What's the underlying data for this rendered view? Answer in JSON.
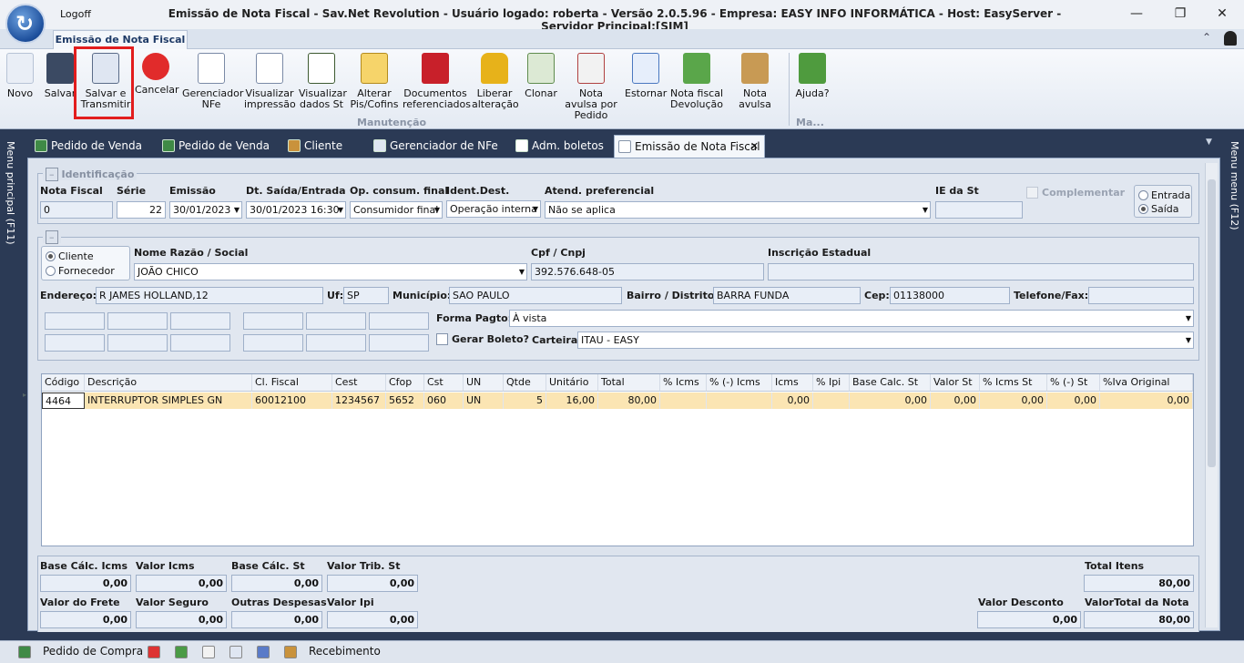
{
  "window": {
    "menu_logoff": "Logoff",
    "title": "Emissão de Nota Fiscal - Sav.Net Revolution - Usuário logado: roberta - Versão 2.0.5.96 - Empresa: EASY INFO INFORMÁTICA - Host: EasyServer - Servidor Principal:[SIM]",
    "minimize_glyph": "—",
    "maximize_glyph": "❐",
    "close_glyph": "✕"
  },
  "ribbon": {
    "tab": "Emissão de Nota Fiscal",
    "collapse_glyph": "⌃",
    "buttons": [
      {
        "label": "Novo",
        "icon": "new-document-icon"
      },
      {
        "label": "Salvar",
        "icon": "floppy-disk-icon"
      },
      {
        "label": "Salvar e Transmitir",
        "icon": "save-transmit-icon"
      },
      {
        "label": "Cancelar",
        "icon": "cancel-red-x-icon"
      },
      {
        "label": "Gerenciador NFe",
        "icon": "nfe-document-icon"
      },
      {
        "label": "Visualizar impressão",
        "icon": "print-preview-icon"
      },
      {
        "label": "Visualizar dados St",
        "icon": "calculator-st-icon"
      },
      {
        "label": "Alterar Pis/Cofins",
        "icon": "edit-pencil-icon"
      },
      {
        "label": "Documentos referenciados",
        "icon": "documents-arrow-icon"
      },
      {
        "label": "Liberar alteração",
        "icon": "padlock-icon"
      },
      {
        "label": "Clonar",
        "icon": "clone-icon"
      },
      {
        "label": "Nota avulsa por Pedido",
        "icon": "invoice-dollar-icon"
      },
      {
        "label": "Estornar",
        "icon": "reverse-icon"
      },
      {
        "label": "Nota fiscal Devolução",
        "icon": "return-invoice-icon"
      },
      {
        "label": "Nota avulsa",
        "icon": "clipboard-icon"
      },
      {
        "label": "Ajuda?",
        "icon": "help-book-icon"
      }
    ],
    "group_manutencao": "Manutenção",
    "group_ma": "Ma..."
  },
  "side": {
    "left": "Menu principal (F11)",
    "right": "Menu menu (F12)"
  },
  "doc_tabs": [
    {
      "label": "Pedido de Venda"
    },
    {
      "label": "Pedido de Venda"
    },
    {
      "label": "Cliente"
    },
    {
      "label": "Gerenciador de NFe"
    },
    {
      "label": "Adm. boletos"
    },
    {
      "label": "Emissão de Nota Fiscal",
      "close": "✕"
    }
  ],
  "identificacao": {
    "section": "Identificação",
    "nota_fiscal_label": "Nota Fiscal",
    "nota_fiscal": "0",
    "serie_label": "Série",
    "serie": "22",
    "emissao_label": "Emissão",
    "emissao": "30/01/2023",
    "dt_saida_label": "Dt. Saída/Entrada",
    "dt_saida": "30/01/2023 16:30",
    "op_consum_label": "Op. consum. final",
    "op_consum": "Consumidor final",
    "ident_dest_label": "Ident.Dest.",
    "ident_dest": "Operação interna",
    "atend_label": "Atend. preferencial",
    "atend": "Não se aplica",
    "ie_st_label": "IE da St",
    "ie_st": "",
    "complementar": "Complementar",
    "entrada": "Entrada",
    "saida": "Saída"
  },
  "destinatario": {
    "cliente": "Cliente",
    "fornecedor": "Fornecedor",
    "nome_label": "Nome Razão / Social",
    "nome": "JOÃO CHICO",
    "cpf_label": "Cpf / Cnpj",
    "cpf": "392.576.648-05",
    "ie_label": "Inscrição Estadual",
    "ie": "",
    "endereco_label": "Endereço:",
    "endereco": "R JAMES HOLLAND,12",
    "uf_label": "Uf:",
    "uf": "SP",
    "municipio_label": "Município:",
    "municipio": "SAO PAULO",
    "bairro_label": "Bairro / Distrito:",
    "bairro": "BARRA FUNDA",
    "cep_label": "Cep:",
    "cep": "01138000",
    "telefone_label": "Telefone/Fax:",
    "telefone": "",
    "forma_pagto_label": "Forma Pagto:",
    "forma_pagto": "À vista",
    "gerar_boleto_label": "Gerar Boleto?",
    "carteira_label": "Carteira:",
    "carteira": "ITAU - EASY"
  },
  "items": {
    "headers": [
      "Código",
      "Descrição",
      "Cl. Fiscal",
      "Cest",
      "Cfop",
      "Cst",
      "UN",
      "Qtde",
      "Unitário",
      "Total",
      "% Icms",
      "% (-) Icms",
      "Icms",
      "% Ipi",
      "Base Calc. St",
      "Valor St",
      "% Icms St",
      "% (-) St",
      "%Iva Original"
    ],
    "rows": [
      [
        "4464",
        "INTERRUPTOR SIMPLES GN",
        "60012100",
        "1234567",
        "5652",
        "060",
        "UN",
        "5",
        "16,00",
        "80,00",
        "",
        "",
        "0,00",
        "",
        "0,00",
        "0,00",
        "0,00",
        "0,00",
        "0,00"
      ]
    ]
  },
  "totais": {
    "base_icms_label": "Base Cálc. Icms",
    "base_icms": "0,00",
    "valor_icms_label": "Valor Icms",
    "valor_icms": "0,00",
    "base_st_label": "Base Cálc. St",
    "base_st": "0,00",
    "valor_trib_st_label": "Valor Trib. St",
    "valor_trib_st": "0,00",
    "total_itens_label": "Total Itens",
    "total_itens": "80,00",
    "frete_label": "Valor do Frete",
    "frete": "0,00",
    "seguro_label": "Valor Seguro",
    "seguro": "0,00",
    "outras_label": "Outras Despesas",
    "outras": "0,00",
    "ipi_label": "Valor Ipi",
    "ipi": "0,00",
    "desconto_label": "Valor Desconto",
    "desconto": "0,00",
    "total_nota_label": "ValorTotal da Nota",
    "total_nota": "80,00"
  },
  "statusbar": {
    "pedido_compra": "Pedido de Compra",
    "recebimento": "Recebimento"
  }
}
